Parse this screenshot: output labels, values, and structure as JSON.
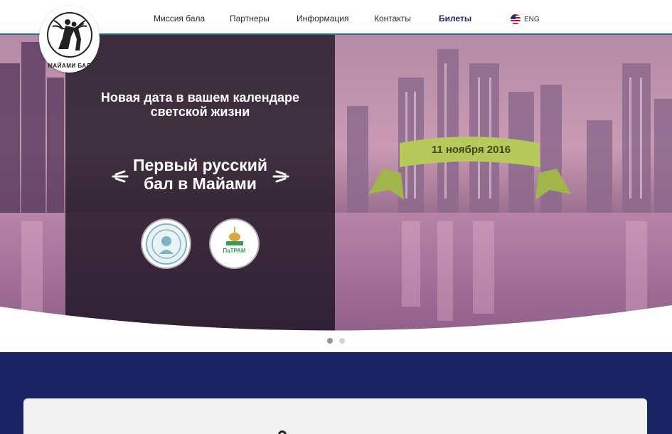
{
  "header": {
    "nav": [
      {
        "label": "Миссия бала"
      },
      {
        "label": "Партнеры"
      },
      {
        "label": "Информация"
      },
      {
        "label": "Контакты"
      },
      {
        "label": "Билеты"
      }
    ],
    "lang_label": "ENG",
    "lang_icon": "us-flag-icon"
  },
  "logo": {
    "text": "МАЙАМИ БАЛ"
  },
  "hero": {
    "tagline_line1": "Новая дата в вашем календаре",
    "tagline_line2": "светской жизни",
    "headline_line1": "Первый русский",
    "headline_line2": "бал в Майами",
    "date": "11 ноября 2016",
    "badge_left_icon": "seal-icon",
    "badge_right_text": "ПаТРАМ",
    "ribbon_color": "#b7c95a"
  },
  "slider": {
    "count": 2,
    "active": 1
  },
  "colors": {
    "nav_accent": "#1f6f97",
    "section_bg": "#1b2462",
    "card_bg": "#f3f3f3"
  }
}
